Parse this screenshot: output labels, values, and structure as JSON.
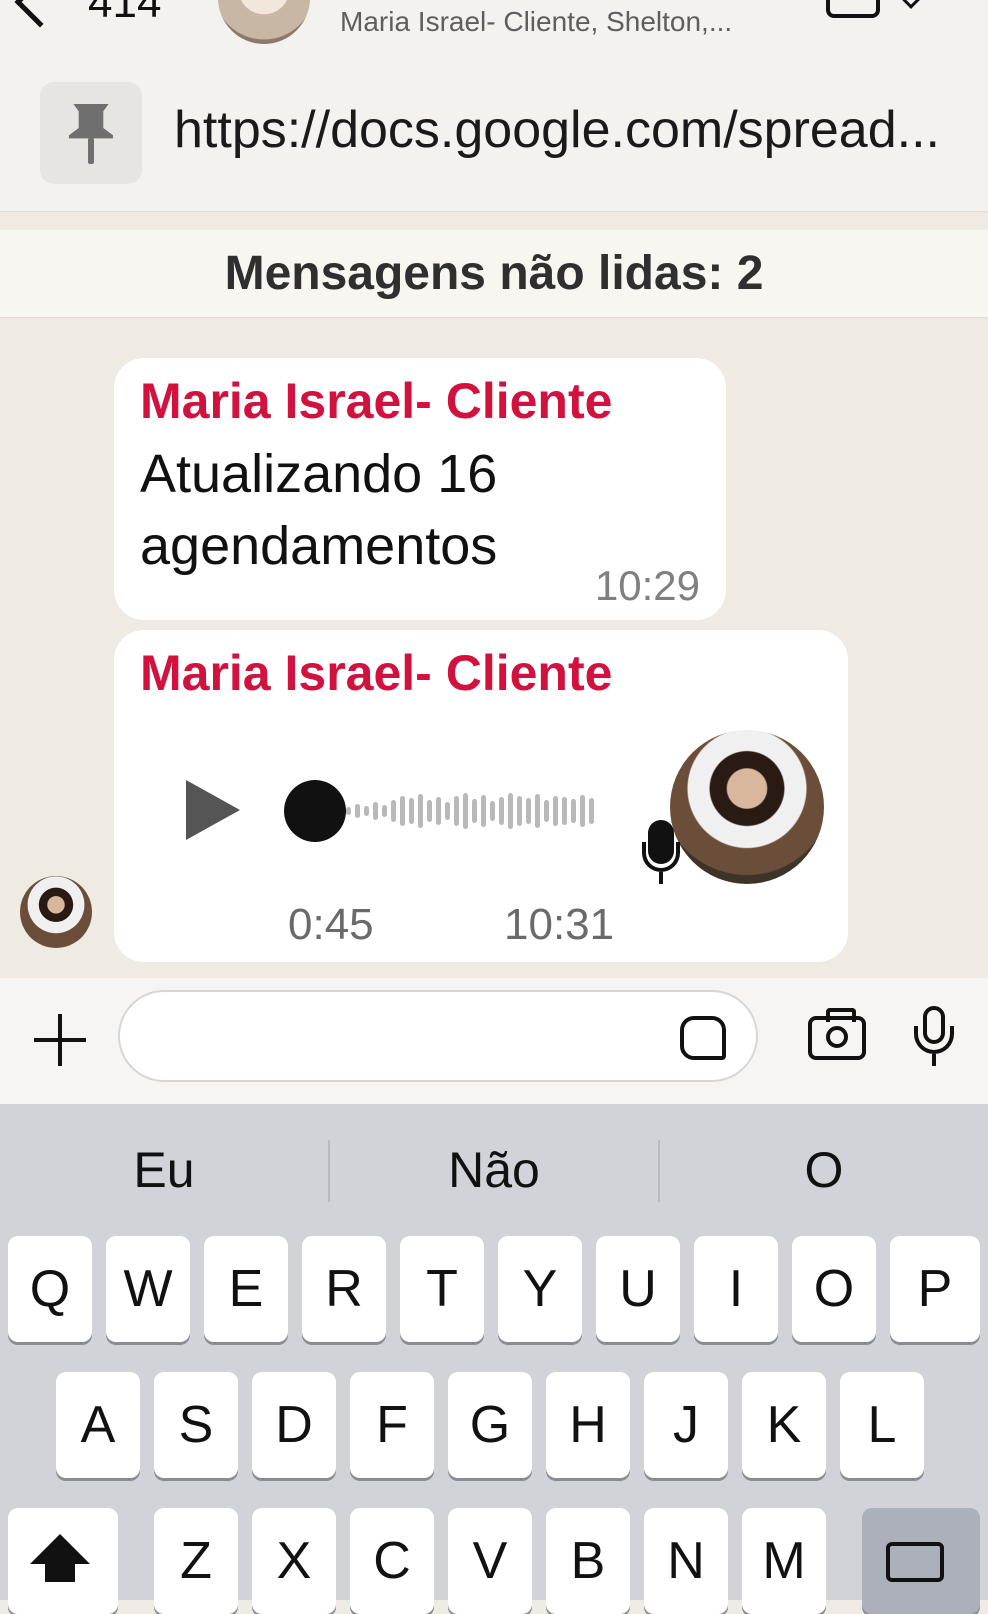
{
  "header": {
    "back_count": "414",
    "subtitle": "Maria Israel- Cliente, Shelton,..."
  },
  "pinned": {
    "text": "https://docs.google.com/spread..."
  },
  "chat": {
    "unread_label": "Mensagens não lidas: 2",
    "messages": [
      {
        "sender": "Maria Israel- Cliente",
        "text": "Atualizando 16 agendamentos",
        "time": "10:29"
      },
      {
        "sender": "Maria Israel- Cliente",
        "type": "voice",
        "duration": "0:45",
        "time": "10:31",
        "progress": 0
      }
    ]
  },
  "composer": {
    "value": "",
    "placeholder": ""
  },
  "keyboard": {
    "suggestions": [
      "Eu",
      "Não",
      "O"
    ],
    "row1": [
      "Q",
      "W",
      "E",
      "R",
      "T",
      "Y",
      "U",
      "I",
      "O",
      "P"
    ],
    "row2": [
      "A",
      "S",
      "D",
      "F",
      "G",
      "H",
      "J",
      "K",
      "L"
    ],
    "row3": [
      "Z",
      "X",
      "C",
      "V",
      "B",
      "N",
      "M"
    ]
  },
  "colors": {
    "sender": "#d1123f",
    "chat_background": "#efeae2",
    "keyboard_background": "#d1d3d9"
  }
}
